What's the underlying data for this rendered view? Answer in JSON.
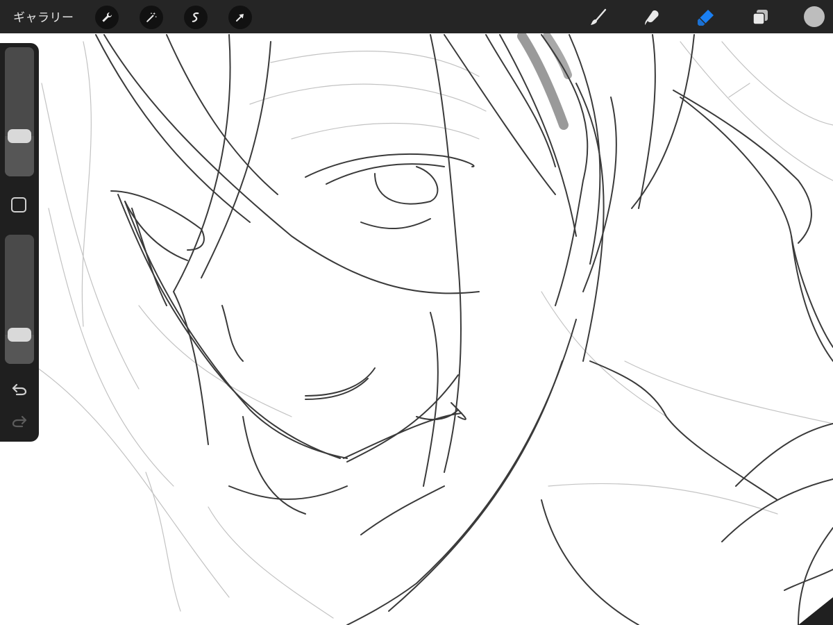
{
  "app": {
    "gallery_label": "ギャラリー"
  },
  "toolbar": {
    "left_icons": [
      "wrench-icon",
      "magic-wand-icon",
      "selection-s-icon",
      "transform-arrow-icon"
    ],
    "right_icons": [
      "brush-icon",
      "smudge-icon",
      "eraser-icon",
      "layers-icon"
    ],
    "active_tool": "eraser",
    "accent_color": "#1a7ff2",
    "current_color": "#bdbdbd"
  },
  "sidebar": {
    "brush_size_level": 0.28,
    "opacity_level": 0.18,
    "modify_icon": "modify-square-icon",
    "undo_icon": "undo-icon",
    "redo_icon": "redo-icon"
  },
  "colors": {
    "toolbar_bg": "#252525",
    "sidebar_bg": "#1f1f1f",
    "canvas_bg": "#ffffff",
    "stroke": "#3a3a3a"
  }
}
